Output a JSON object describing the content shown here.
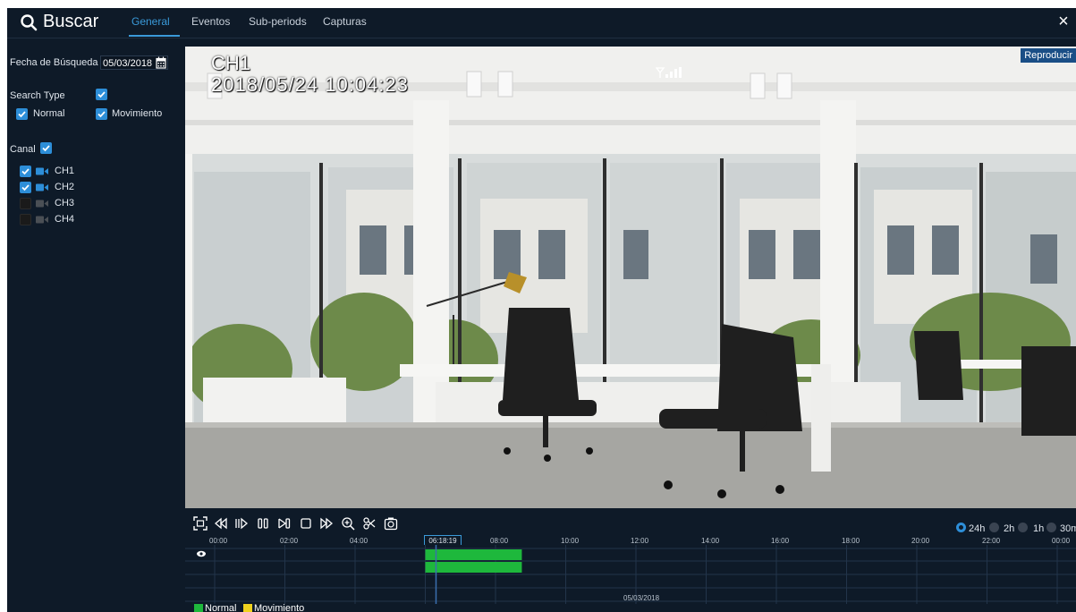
{
  "header": {
    "title": "Buscar",
    "tabs": [
      {
        "label": "General",
        "active": true
      },
      {
        "label": "Eventos",
        "active": false
      },
      {
        "label": "Sub-periods",
        "active": false
      },
      {
        "label": "Capturas",
        "active": false
      }
    ],
    "close_symbol": "×"
  },
  "sidebar": {
    "date_label": "Fecha de Búsqueda",
    "date_value": "05/03/2018",
    "search_type_label": "Search Type",
    "search_type_checked": true,
    "type_normal": {
      "label": "Normal",
      "checked": true
    },
    "type_motion": {
      "label": "Movimiento",
      "checked": true
    },
    "channel_label": "Canal",
    "channel_all_checked": true,
    "channels": [
      {
        "label": "CH1",
        "checked": true
      },
      {
        "label": "CH2",
        "checked": true
      },
      {
        "label": "CH3",
        "checked": false
      },
      {
        "label": "CH4",
        "checked": false
      }
    ]
  },
  "video": {
    "channel": "CH1",
    "timestamp": "2018/05/24  10:04:23",
    "play_label": "Reproducir"
  },
  "controls": {
    "icons": [
      "fullscreen-icon",
      "rewind-icon",
      "slow-play-icon",
      "pause-icon",
      "step-frame-icon",
      "stop-icon",
      "fast-forward-icon",
      "zoom-icon",
      "clip-icon",
      "snapshot-icon"
    ],
    "ranges": [
      {
        "label": "24h",
        "selected": true
      },
      {
        "label": "2h",
        "selected": false
      },
      {
        "label": "1h",
        "selected": false
      },
      {
        "label": "30m",
        "selected": false
      }
    ]
  },
  "timeline": {
    "ticks": [
      "00:00",
      "02:00",
      "04:00",
      "06:00",
      "08:00",
      "10:00",
      "12:00",
      "14:00",
      "16:00",
      "18:00",
      "20:00",
      "22:00",
      "00:00"
    ],
    "cursor_time": "06:18:19",
    "date": "05/03/2018",
    "recordings": [
      {
        "channel": "CH1",
        "type": "Normal",
        "start": "06:00",
        "end": "08:45"
      },
      {
        "channel": "CH2",
        "type": "Normal",
        "start": "06:00",
        "end": "08:45"
      }
    ]
  },
  "legend": {
    "normal": "Normal",
    "motion": "Movimiento",
    "normal_color": "#1eb83c",
    "motion_color": "#f0d21e"
  },
  "colors": {
    "accent": "#3a9ad9",
    "background": "#0e1a28",
    "checkbox": "#2d8ed8"
  }
}
